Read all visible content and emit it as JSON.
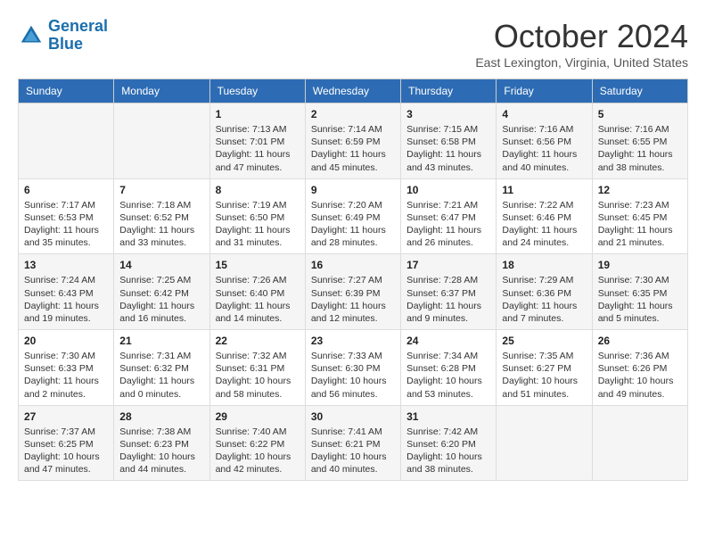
{
  "logo": {
    "line1": "General",
    "line2": "Blue"
  },
  "title": "October 2024",
  "location": "East Lexington, Virginia, United States",
  "days_of_week": [
    "Sunday",
    "Monday",
    "Tuesday",
    "Wednesday",
    "Thursday",
    "Friday",
    "Saturday"
  ],
  "weeks": [
    [
      {
        "day": "",
        "info": ""
      },
      {
        "day": "",
        "info": ""
      },
      {
        "day": "1",
        "info": "Sunrise: 7:13 AM\nSunset: 7:01 PM\nDaylight: 11 hours and 47 minutes."
      },
      {
        "day": "2",
        "info": "Sunrise: 7:14 AM\nSunset: 6:59 PM\nDaylight: 11 hours and 45 minutes."
      },
      {
        "day": "3",
        "info": "Sunrise: 7:15 AM\nSunset: 6:58 PM\nDaylight: 11 hours and 43 minutes."
      },
      {
        "day": "4",
        "info": "Sunrise: 7:16 AM\nSunset: 6:56 PM\nDaylight: 11 hours and 40 minutes."
      },
      {
        "day": "5",
        "info": "Sunrise: 7:16 AM\nSunset: 6:55 PM\nDaylight: 11 hours and 38 minutes."
      }
    ],
    [
      {
        "day": "6",
        "info": "Sunrise: 7:17 AM\nSunset: 6:53 PM\nDaylight: 11 hours and 35 minutes."
      },
      {
        "day": "7",
        "info": "Sunrise: 7:18 AM\nSunset: 6:52 PM\nDaylight: 11 hours and 33 minutes."
      },
      {
        "day": "8",
        "info": "Sunrise: 7:19 AM\nSunset: 6:50 PM\nDaylight: 11 hours and 31 minutes."
      },
      {
        "day": "9",
        "info": "Sunrise: 7:20 AM\nSunset: 6:49 PM\nDaylight: 11 hours and 28 minutes."
      },
      {
        "day": "10",
        "info": "Sunrise: 7:21 AM\nSunset: 6:47 PM\nDaylight: 11 hours and 26 minutes."
      },
      {
        "day": "11",
        "info": "Sunrise: 7:22 AM\nSunset: 6:46 PM\nDaylight: 11 hours and 24 minutes."
      },
      {
        "day": "12",
        "info": "Sunrise: 7:23 AM\nSunset: 6:45 PM\nDaylight: 11 hours and 21 minutes."
      }
    ],
    [
      {
        "day": "13",
        "info": "Sunrise: 7:24 AM\nSunset: 6:43 PM\nDaylight: 11 hours and 19 minutes."
      },
      {
        "day": "14",
        "info": "Sunrise: 7:25 AM\nSunset: 6:42 PM\nDaylight: 11 hours and 16 minutes."
      },
      {
        "day": "15",
        "info": "Sunrise: 7:26 AM\nSunset: 6:40 PM\nDaylight: 11 hours and 14 minutes."
      },
      {
        "day": "16",
        "info": "Sunrise: 7:27 AM\nSunset: 6:39 PM\nDaylight: 11 hours and 12 minutes."
      },
      {
        "day": "17",
        "info": "Sunrise: 7:28 AM\nSunset: 6:37 PM\nDaylight: 11 hours and 9 minutes."
      },
      {
        "day": "18",
        "info": "Sunrise: 7:29 AM\nSunset: 6:36 PM\nDaylight: 11 hours and 7 minutes."
      },
      {
        "day": "19",
        "info": "Sunrise: 7:30 AM\nSunset: 6:35 PM\nDaylight: 11 hours and 5 minutes."
      }
    ],
    [
      {
        "day": "20",
        "info": "Sunrise: 7:30 AM\nSunset: 6:33 PM\nDaylight: 11 hours and 2 minutes."
      },
      {
        "day": "21",
        "info": "Sunrise: 7:31 AM\nSunset: 6:32 PM\nDaylight: 11 hours and 0 minutes."
      },
      {
        "day": "22",
        "info": "Sunrise: 7:32 AM\nSunset: 6:31 PM\nDaylight: 10 hours and 58 minutes."
      },
      {
        "day": "23",
        "info": "Sunrise: 7:33 AM\nSunset: 6:30 PM\nDaylight: 10 hours and 56 minutes."
      },
      {
        "day": "24",
        "info": "Sunrise: 7:34 AM\nSunset: 6:28 PM\nDaylight: 10 hours and 53 minutes."
      },
      {
        "day": "25",
        "info": "Sunrise: 7:35 AM\nSunset: 6:27 PM\nDaylight: 10 hours and 51 minutes."
      },
      {
        "day": "26",
        "info": "Sunrise: 7:36 AM\nSunset: 6:26 PM\nDaylight: 10 hours and 49 minutes."
      }
    ],
    [
      {
        "day": "27",
        "info": "Sunrise: 7:37 AM\nSunset: 6:25 PM\nDaylight: 10 hours and 47 minutes."
      },
      {
        "day": "28",
        "info": "Sunrise: 7:38 AM\nSunset: 6:23 PM\nDaylight: 10 hours and 44 minutes."
      },
      {
        "day": "29",
        "info": "Sunrise: 7:40 AM\nSunset: 6:22 PM\nDaylight: 10 hours and 42 minutes."
      },
      {
        "day": "30",
        "info": "Sunrise: 7:41 AM\nSunset: 6:21 PM\nDaylight: 10 hours and 40 minutes."
      },
      {
        "day": "31",
        "info": "Sunrise: 7:42 AM\nSunset: 6:20 PM\nDaylight: 10 hours and 38 minutes."
      },
      {
        "day": "",
        "info": ""
      },
      {
        "day": "",
        "info": ""
      }
    ]
  ]
}
